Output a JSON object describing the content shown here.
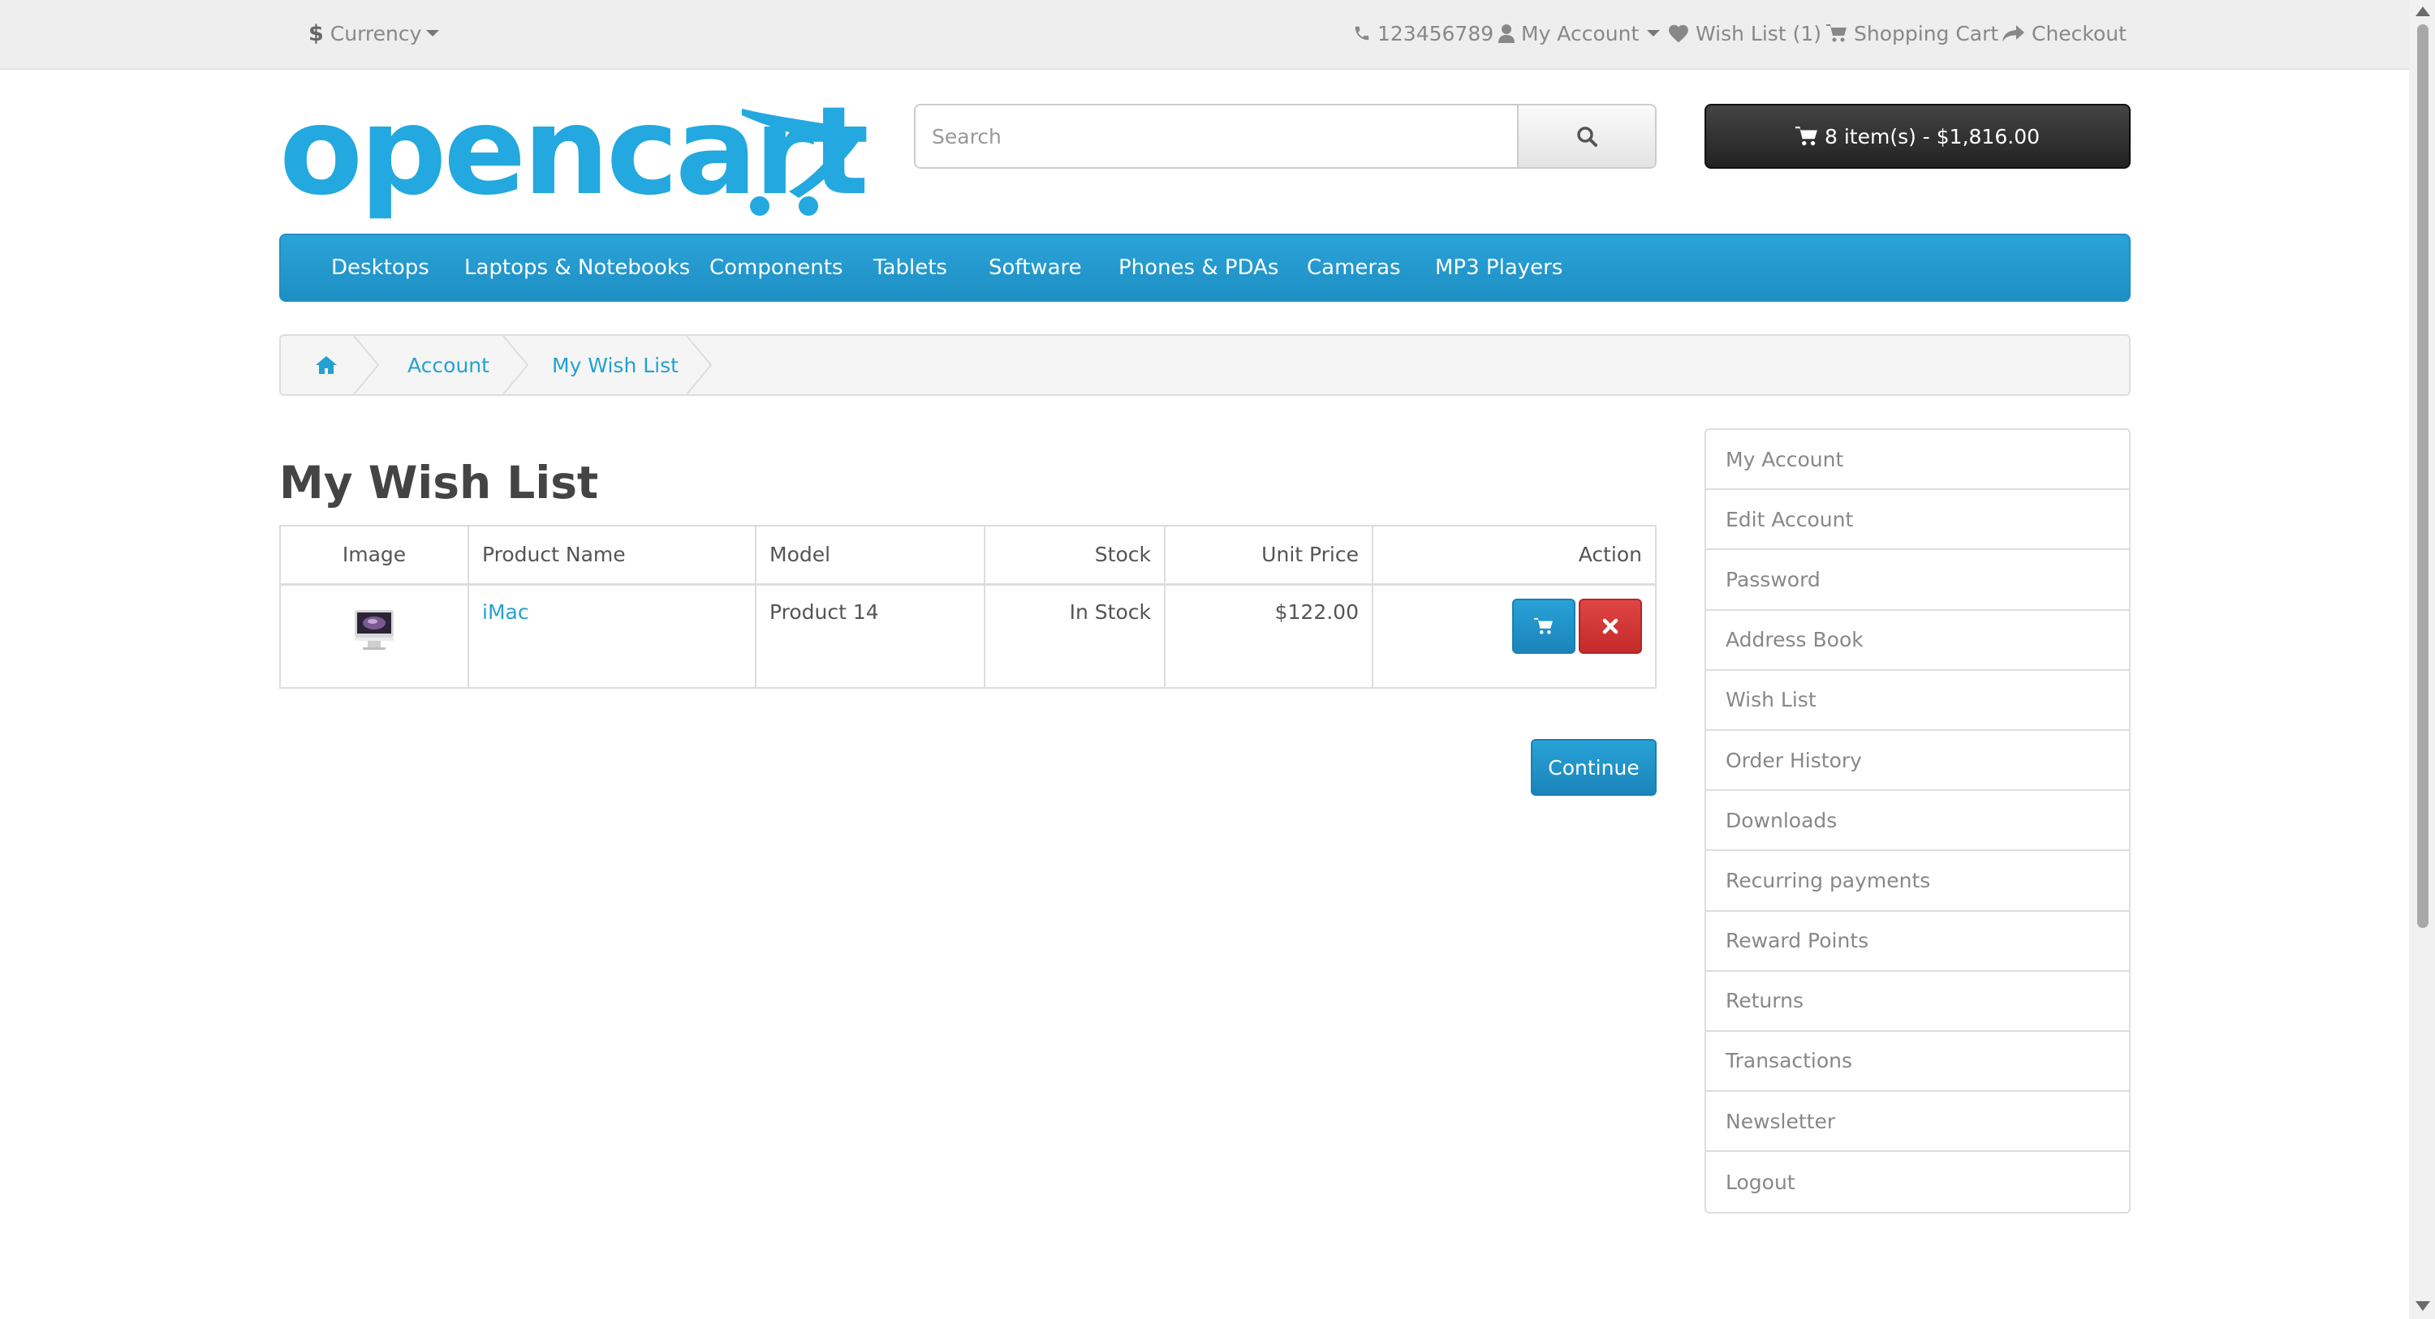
{
  "topbar": {
    "currency_symbol": "$",
    "currency_label": "Currency",
    "phone": "123456789",
    "my_account": "My Account",
    "wish_list": "Wish List (1)",
    "shopping_cart": "Shopping Cart",
    "checkout": "Checkout"
  },
  "header": {
    "logo_text": "opencart",
    "search_placeholder": "Search",
    "cart_summary": "8 item(s) - $1,816.00"
  },
  "menu": {
    "items": [
      "Desktops",
      "Laptops & Notebooks",
      "Components",
      "Tablets",
      "Software",
      "Phones & PDAs",
      "Cameras",
      "MP3 Players"
    ]
  },
  "breadcrumb": {
    "items": [
      "Account",
      "My Wish List"
    ]
  },
  "main": {
    "title": "My Wish List",
    "table": {
      "headers": [
        "Image",
        "Product Name",
        "Model",
        "Stock",
        "Unit Price",
        "Action"
      ],
      "rows": [
        {
          "product": "iMac",
          "model": "Product 14",
          "stock": "In Stock",
          "price": "$122.00"
        }
      ]
    },
    "continue_label": "Continue"
  },
  "sidebar": {
    "items": [
      "My Account",
      "Edit Account",
      "Password",
      "Address Book",
      "Wish List",
      "Order History",
      "Downloads",
      "Recurring payments",
      "Reward Points",
      "Returns",
      "Transactions",
      "Newsletter",
      "Logout"
    ]
  },
  "colors": {
    "brand_blue": "#229ac8",
    "link_blue": "#23a1d1",
    "danger_red": "#d9363e",
    "cart_dark": "#303030"
  }
}
